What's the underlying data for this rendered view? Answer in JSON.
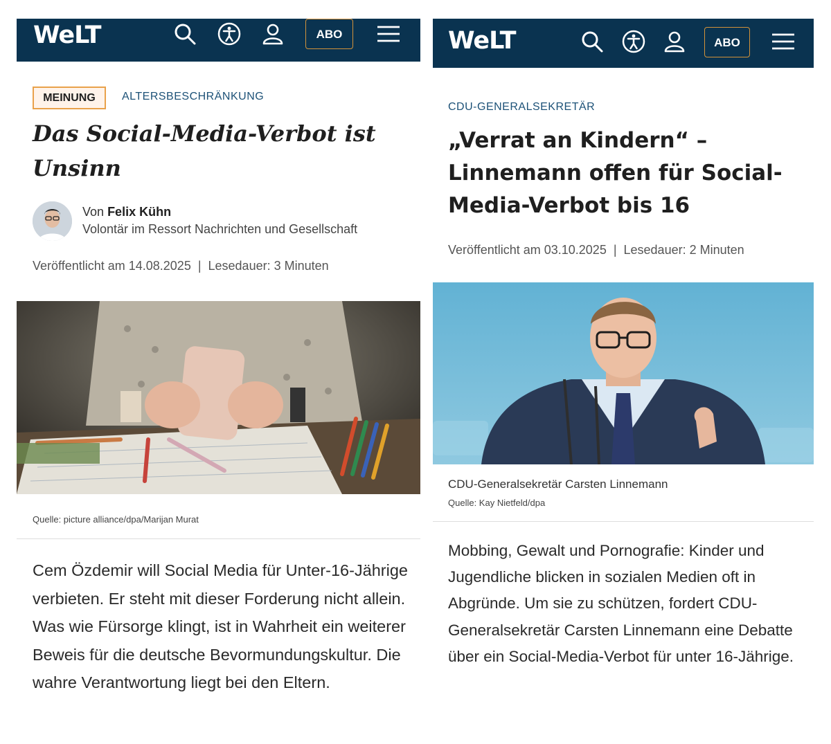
{
  "left": {
    "header": {
      "logo": "WeLT",
      "abo_label": "ABO"
    },
    "badge": "MEINUNG",
    "kicker": "ALTERSBESCHRÄNKUNG",
    "headline": "Das Social-Media-Verbot ist Unsinn",
    "author": {
      "prefix": "Von",
      "name": "Felix Kühn",
      "role": "Volontär im Ressort Nachrichten und Gesellschaft"
    },
    "meta": "Veröffentlicht am 14.08.2025  |  Lesedauer: 3 Minuten",
    "image_source": "Quelle: picture alliance/dpa/Marijan Murat",
    "lead": "Cem Özdemir will Social Media für Unter-16-Jährige verbieten. Er steht mit dieser Forderung nicht allein. Was wie Fürsorge klingt, ist in Wahrheit ein weiterer Beweis für die deutsche Bevormundungskultur. Die wahre Verantwortung liegt bei den Eltern."
  },
  "right": {
    "header": {
      "logo": "WeLT",
      "abo_label": "ABO"
    },
    "kicker": "CDU-GENERALSEKRETÄR",
    "headline": "„Verrat an Kindern“ – Linnemann offen für Social-Media-Verbot bis 16",
    "meta": "Veröffentlicht am 03.10.2025  |  Lesedauer: 2 Minuten",
    "image_caption": "CDU-Generalsekretär Carsten Linnemann",
    "image_source": "Quelle: Kay Nietfeld/dpa",
    "lead": "Mobbing, Gewalt und Pornografie: Kinder und Jugendliche blicken in sozialen Medien oft in Abgründe. Um sie zu schützen, fordert CDU-Generalsekretär Carsten Linnemann eine Debatte über ein Social-Media-Verbot für unter 16-Jährige."
  },
  "icons": [
    "search-icon",
    "accessibility-icon",
    "user-icon",
    "menu-icon"
  ],
  "colors": {
    "header_bg": "#0a3350",
    "abo_border": "#d4933a",
    "badge_border": "#e9a14a",
    "kicker": "#1c5177"
  }
}
